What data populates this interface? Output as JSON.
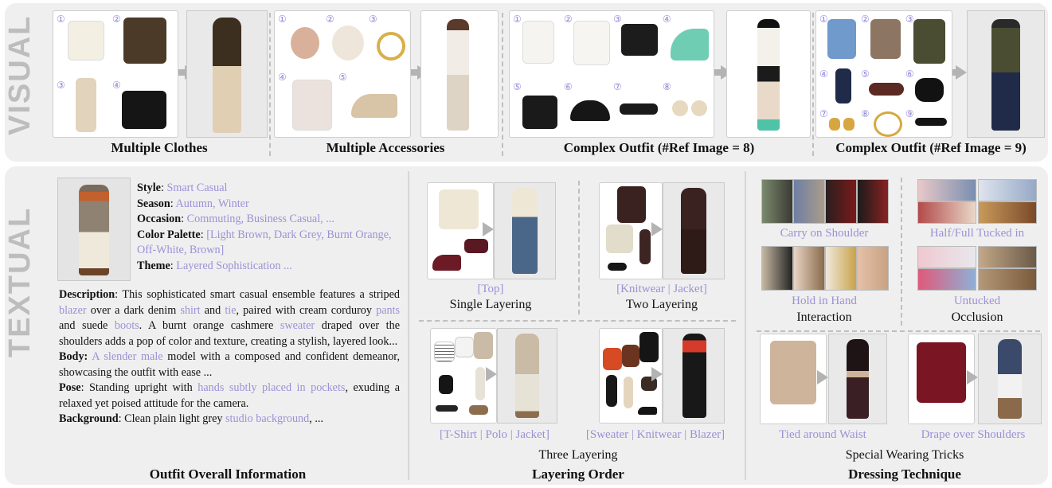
{
  "visual": {
    "side_label": "VISUAL",
    "sections": [
      {
        "caption": "Multiple Clothes"
      },
      {
        "caption": "Multiple Accessories"
      },
      {
        "caption": "Complex Outfit (#Ref Image = 8)"
      },
      {
        "caption": "Complex Outfit (#Ref Image = 9)"
      }
    ],
    "markers": [
      "①",
      "②",
      "③",
      "④",
      "⑤",
      "⑥",
      "⑦",
      "⑧",
      "⑨"
    ]
  },
  "textual": {
    "side_label": "TEXTUAL",
    "outfit": {
      "style_label": "Style",
      "style_value": "Smart Casual",
      "season_label": "Season",
      "season_value": "Autumn, Winter",
      "occasion_label": "Occasion",
      "occasion_value": "Commuting, Business Casual, ...",
      "palette_label": "Color Palette",
      "palette_value": "[Light Brown, Dark Grey, Burnt Orange, Off-White, Brown]",
      "theme_label": "Theme",
      "theme_value": "Layered Sophistication ...",
      "description_label": "Description",
      "desc_1": "This sophisticated smart casual ensemble features a striped",
      "desc_blazer": "blazer",
      "desc_2": "over a dark denim",
      "desc_shirt": "shirt",
      "desc_3": "and",
      "desc_tie": "tie",
      "desc_4": ", paired with cream corduroy",
      "desc_pants": "pants",
      "desc_5": "and suede",
      "desc_boots": "boots",
      "desc_6": ". A burnt orange cashmere",
      "desc_sweater": "sweater",
      "desc_7": "draped over the shoulders adds a pop of color and texture, creating a stylish, layered look...",
      "body_label": "Body:",
      "body_purple": "A slender male",
      "body_rest": "model with a composed and confident demeanor, showcasing the outfit with ease ...",
      "pose_label": "Pose",
      "pose_1": "Standing upright with",
      "pose_purple": "hands subtly placed in pockets",
      "pose_2": ", exuding a relaxed yet poised attitude for the camera.",
      "background_label": "Background",
      "background_1": "Clean plain light grey",
      "background_purple": "studio background",
      "background_2": ", ...",
      "caption": "Outfit Overall Information"
    },
    "layering": {
      "single_tag": "[Top]",
      "single_label": "Single Layering",
      "two_tag": "[Knitwear | Jacket]",
      "two_label": "Two Layering",
      "three_tag_a": "[T-Shirt | Polo | Jacket]",
      "three_tag_b": "[Sweater | Knitwear | Blazer]",
      "three_label": "Three Layering",
      "caption": "Layering Order"
    },
    "dressing": {
      "carry": "Carry on Shoulder",
      "hold": "Hold in Hand",
      "interaction": "Interaction",
      "tucked": "Half/Full Tucked in",
      "untucked": "Untucked",
      "occlusion": "Occlusion",
      "tied": "Tied around Waist",
      "drape": "Drape over Shoulders",
      "tricks": "Special Wearing Tricks",
      "caption": "Dressing Technique"
    }
  }
}
